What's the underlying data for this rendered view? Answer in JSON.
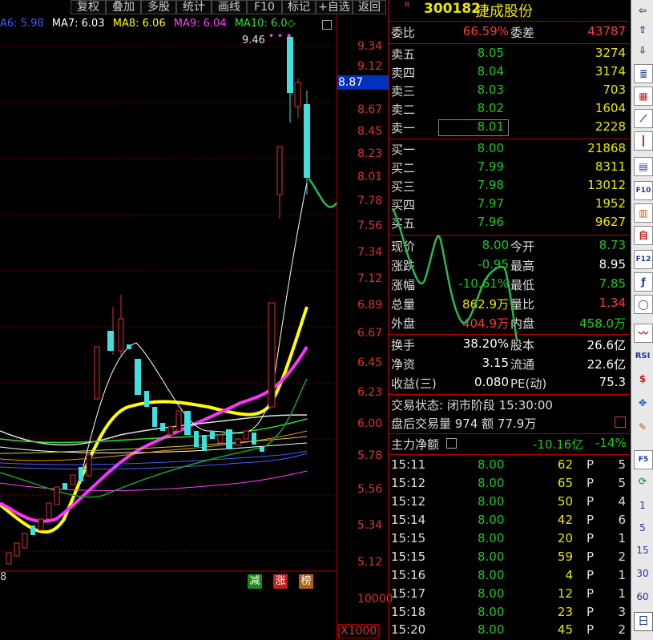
{
  "toolbar": {
    "items": [
      "复权",
      "叠加",
      "多股",
      "统计",
      "画线",
      "F10",
      "标记",
      "+自选",
      "返回"
    ]
  },
  "ma": {
    "ma6": "A6: 5.98",
    "ma7": "MA7: 6.03",
    "ma8": "MA8: 6.06",
    "ma9": "MA9: 6.04",
    "ma10": "MA10: 6.0◇"
  },
  "chart": {
    "high_label": "9.46",
    "price_marker": "8.87",
    "y_ticks": [
      "9.34",
      "9.12",
      "8.89",
      "8.67",
      "8.45",
      "8.23",
      "8.01",
      "7.78",
      "7.56",
      "7.34",
      "7.12",
      "6.89",
      "6.67",
      "6.45",
      "6.23",
      "6.00",
      "5.78",
      "5.56",
      "5.34",
      "5.12"
    ],
    "left_label": "8",
    "tags": [
      "减",
      "涨",
      "榜"
    ],
    "vol_ticks": [
      "10000",
      "X1000"
    ]
  },
  "stock": {
    "code": "300182",
    "name": "捷成股份",
    "badge_r": "R"
  },
  "orderbook": {
    "ratio_label": "委比",
    "ratio": "66.59%",
    "diff_label": "委差",
    "diff": "43787",
    "asks": [
      {
        "label": "卖五",
        "price": "8.05",
        "vol": "3274"
      },
      {
        "label": "卖四",
        "price": "8.04",
        "vol": "3174"
      },
      {
        "label": "卖三",
        "price": "8.03",
        "vol": "703"
      },
      {
        "label": "卖二",
        "price": "8.02",
        "vol": "1604"
      },
      {
        "label": "卖一",
        "price": "8.01",
        "vol": "2228"
      }
    ],
    "bids": [
      {
        "label": "买一",
        "price": "8.00",
        "vol": "21868"
      },
      {
        "label": "买二",
        "price": "7.99",
        "vol": "8311"
      },
      {
        "label": "买三",
        "price": "7.98",
        "vol": "13012"
      },
      {
        "label": "买四",
        "price": "7.97",
        "vol": "1952"
      },
      {
        "label": "买五",
        "price": "7.96",
        "vol": "9627"
      }
    ]
  },
  "quote": {
    "rows": [
      {
        "l1": "现价",
        "v1": "8.00",
        "l2": "今开",
        "v2": "8.73"
      },
      {
        "l1": "涨跌",
        "v1": "-0.95",
        "l2": "最高",
        "v2": "8.95"
      },
      {
        "l1": "涨幅",
        "v1": "-10.61%",
        "l2": "最低",
        "v2": "7.85"
      },
      {
        "l1": "总量",
        "v1": "862.9万",
        "l2": "量比",
        "v2": "1.34"
      },
      {
        "l1": "外盘",
        "v1": "404.9万",
        "l2": "内盘",
        "v2": "458.0万"
      }
    ],
    "rows2": [
      {
        "l1": "换手",
        "v1": "38.20%",
        "l2": "股本",
        "v2": "26.6亿"
      },
      {
        "l1": "净资",
        "v1": "3.15",
        "l2": "流通",
        "v2": "22.6亿"
      },
      {
        "l1": "收益(三)",
        "v1": "0.080",
        "l2": "PE(动)",
        "v2": "75.3"
      }
    ],
    "status": "交易状态: 闭市阶段 15:30:00",
    "after": "盘后交易量 974 额 77.9万",
    "main_flow_label": "主力净额",
    "main_flow": "-10.16亿",
    "main_flow_pct": "-14%"
  },
  "ticks": [
    {
      "time": "15:11",
      "price": "8.00",
      "vol": "62",
      "flag": "P",
      "n": "5"
    },
    {
      "time": "15:12",
      "price": "8.00",
      "vol": "65",
      "flag": "P",
      "n": "5"
    },
    {
      "time": "15:12",
      "price": "8.00",
      "vol": "50",
      "flag": "P",
      "n": "4"
    },
    {
      "time": "15:14",
      "price": "8.00",
      "vol": "42",
      "flag": "P",
      "n": "6"
    },
    {
      "time": "15:15",
      "price": "8.00",
      "vol": "20",
      "flag": "P",
      "n": "1"
    },
    {
      "time": "15:15",
      "price": "8.00",
      "vol": "59",
      "flag": "P",
      "n": "2"
    },
    {
      "time": "15:16",
      "price": "8.00",
      "vol": "4",
      "flag": "P",
      "n": "1"
    },
    {
      "time": "15:17",
      "price": "8.00",
      "vol": "12",
      "flag": "P",
      "n": "1"
    },
    {
      "time": "15:18",
      "price": "8.00",
      "vol": "23",
      "flag": "P",
      "n": "3"
    },
    {
      "time": "15:20",
      "price": "8.00",
      "vol": "45",
      "flag": "P",
      "n": "2"
    }
  ],
  "sidebar": {
    "icons": [
      "arrow-left-icon",
      "arrow-up-icon",
      "arrow-down-icon",
      "list-icon",
      "grid-icon",
      "line-chart-icon",
      "candle-icon",
      "page-icon",
      "f10-icon",
      "report-icon",
      "self-icon",
      "f12-icon",
      "formula-icon",
      "circle-icon",
      "wave-icon",
      "rsi-icon",
      "money-icon",
      "move-icon",
      "pen-icon",
      "f5-icon",
      "refresh-icon"
    ],
    "labels": {
      "f10": "F10",
      "f12": "F12",
      "rsi": "RSI",
      "f5": "F5"
    },
    "periods": [
      "1",
      "5",
      "15",
      "30",
      "60"
    ],
    "day": "日"
  }
}
